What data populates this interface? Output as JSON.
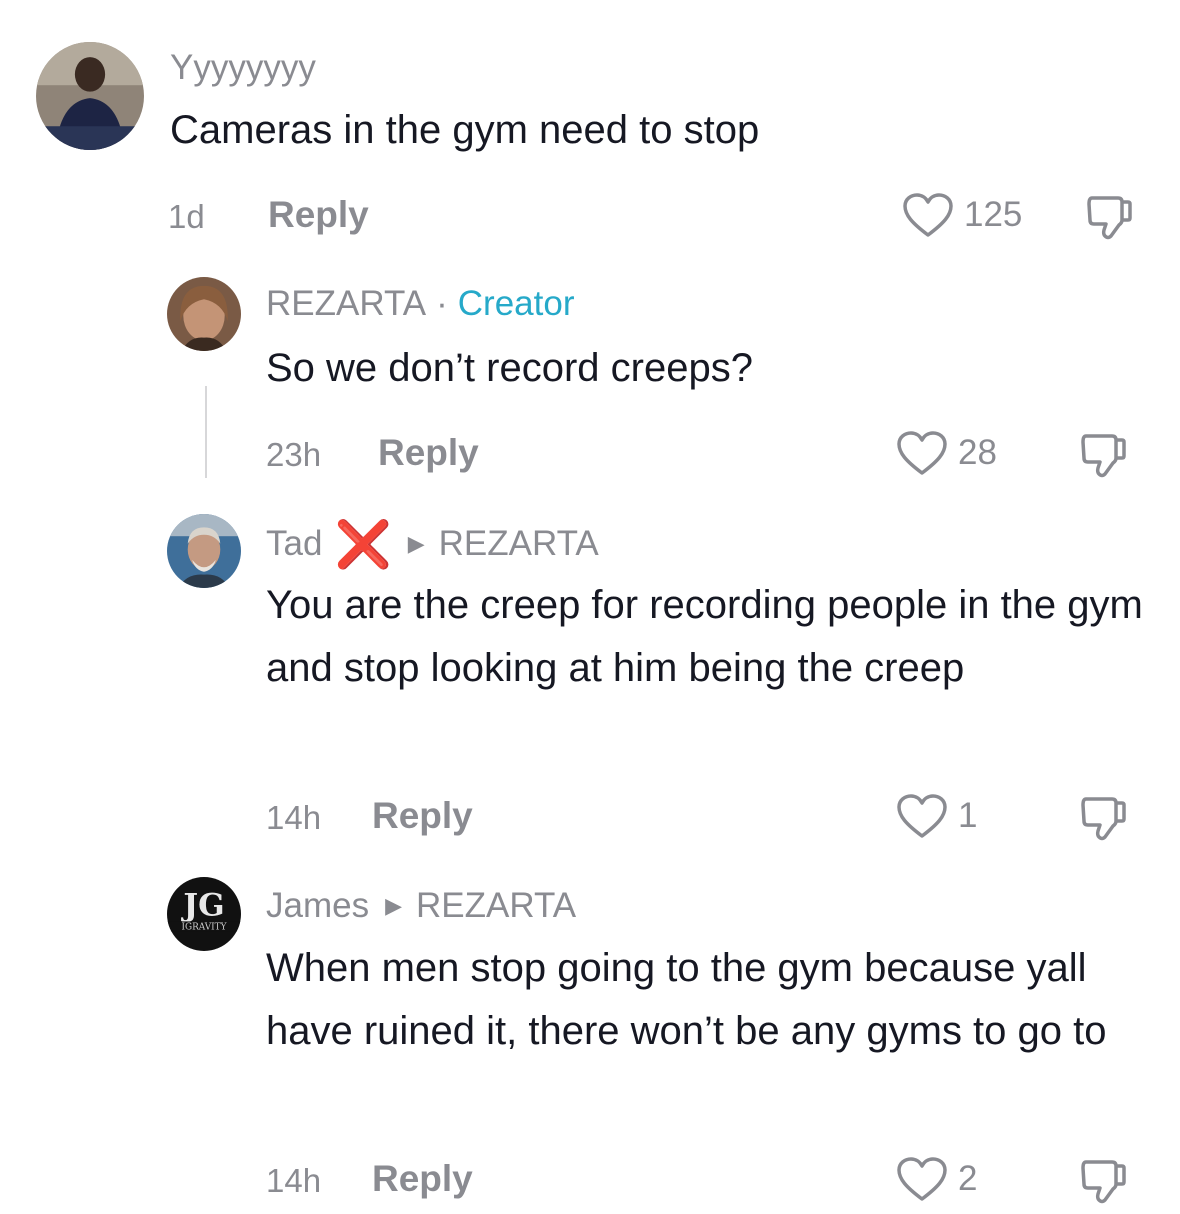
{
  "comments": [
    {
      "username": "Yyyyyyyy",
      "text": "Cameras in the gym need to stop",
      "time": "1d",
      "reply": "Reply",
      "likes": "125"
    },
    {
      "username": "REZARTA",
      "badge": "Creator",
      "text": "So we don’t record creeps?",
      "time": "23h",
      "reply": "Reply",
      "likes": "28"
    },
    {
      "username": "Tad",
      "flag": "❌",
      "reply_to": "REZARTA",
      "text": "You are the creep for recording people in the gym and stop looking at him being the creep",
      "time": "14h",
      "reply": "Reply",
      "likes": "1"
    },
    {
      "username": "James",
      "reply_to": "REZARTA",
      "avatar_text": "IGRAVITY",
      "text": "When men stop going to the gym because yall have ruined it, there won’t be any gyms to go to",
      "time": "14h",
      "reply": "Reply",
      "likes": "2"
    }
  ],
  "icons": {
    "like": "heart-outline-icon",
    "dislike": "thumbs-down-icon",
    "reply_arrow": "triangle-right-icon"
  },
  "colors": {
    "creator_badge": "#26a9c9",
    "muted": "#8a8b91",
    "text": "#161823",
    "flag": "#e2231a"
  }
}
